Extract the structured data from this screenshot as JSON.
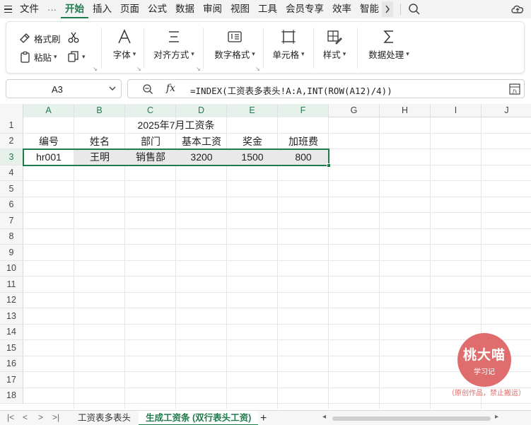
{
  "menu": {
    "file": "文件",
    "more": "···",
    "tabs": [
      "开始",
      "插入",
      "页面",
      "公式",
      "数据",
      "审阅",
      "视图",
      "工具",
      "会员专享",
      "效率",
      "智能"
    ],
    "active_tab": "开始"
  },
  "ribbon": {
    "format_painter": "格式刷",
    "paste": "粘贴",
    "font": "字体",
    "alignment": "对齐方式",
    "number_format": "数字格式",
    "cell": "单元格",
    "style": "样式",
    "data_processing": "数据处理"
  },
  "formula_bar": {
    "name_box": "A3",
    "fx": "fx",
    "formula": "=INDEX(工资表多表头!A:A,INT(ROW(A12)/4))"
  },
  "columns": [
    "A",
    "B",
    "C",
    "D",
    "E",
    "F",
    "G",
    "H",
    "I",
    "J"
  ],
  "rows": [
    "1",
    "2",
    "3",
    "4",
    "5",
    "6",
    "7",
    "8",
    "9",
    "10",
    "11",
    "12",
    "13",
    "14",
    "15",
    "16",
    "17",
    "18"
  ],
  "cells": {
    "title": "2025年7月工资条",
    "headers": [
      "编号",
      "姓名",
      "部门",
      "基本工资",
      "奖金",
      "加班费"
    ],
    "row3": [
      "hr001",
      "王明",
      "销售部",
      "3200",
      "1500",
      "800"
    ]
  },
  "selection": {
    "active_cell": "A3",
    "range": "A3:F3",
    "accent": "#1f7a4c"
  },
  "watermark": {
    "title": "桃大喵",
    "subtitle": "学习记",
    "note": "（原创作品，禁止搬运）",
    "color": "#e06d6d"
  },
  "sheets": {
    "tabs": [
      "工资表多表头",
      "生成工资条 (双行表头工资)"
    ],
    "active": "生成工资条 (双行表头工资)",
    "add": "+"
  }
}
